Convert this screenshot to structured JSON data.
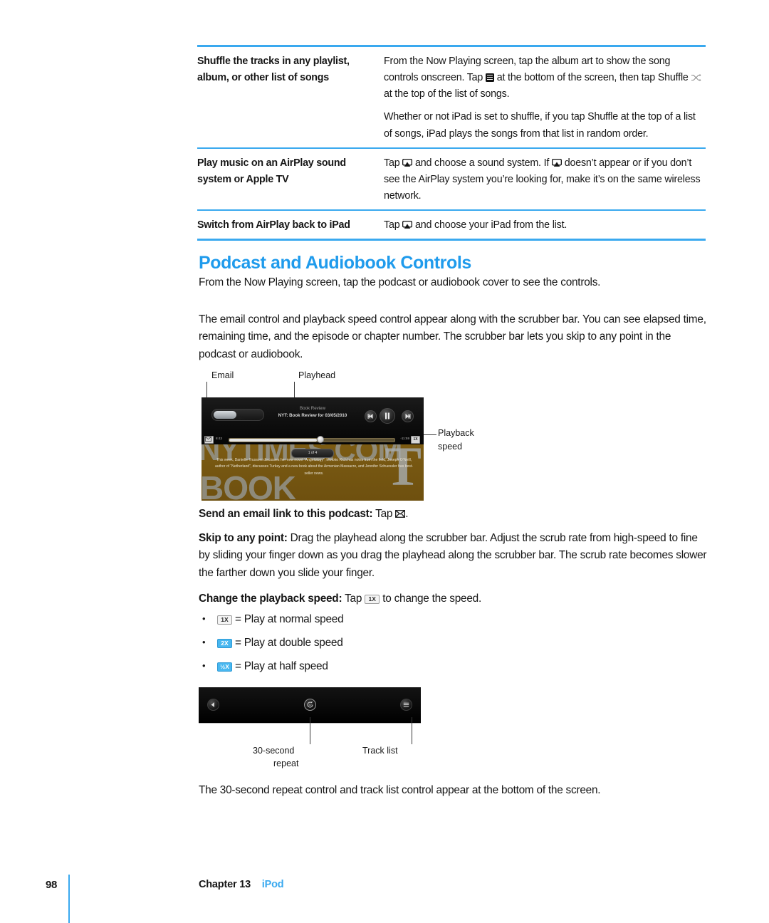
{
  "page": {
    "number": "98",
    "chapter_label": "Chapter 13",
    "section_label": "iPod",
    "accent_blue": "#3aa9ef",
    "heading_blue": "#1f9bec"
  },
  "table": {
    "rows": [
      {
        "task": "Shuffle the tracks in any playlist, album, or other list of songs",
        "steps": [
          "From the Now Playing screen, tap the album art to show the song controls onscreen. Tap  at the bottom of the screen, then tap Shuffle  at the top of the list of songs.",
          "Whether or not iPad is set to shuffle, if you tap Shuffle at the top of a list of songs, iPad plays the songs from that list in random order."
        ],
        "step1_a": "From the Now Playing screen, tap the album art to show the song controls onscreen. Tap",
        "step1_b": "at the bottom of the screen, then tap Shuffle",
        "step1_c": "at the top of the list of songs.",
        "step2": "Whether or not iPad is set to shuffle, if you tap Shuffle at the top of a list of songs, iPad plays the songs from that list in random order."
      },
      {
        "task": "Play music on an AirPlay sound system or Apple TV",
        "step_a": "Tap",
        "step_b": "and choose a sound system. If",
        "step_c": "doesn’t appear or if you don’t see the AirPlay system you’re looking for, make it’s on the same wireless network."
      },
      {
        "task": "Switch from AirPlay back to iPad",
        "step_a": "Tap",
        "step_b": "and choose your iPad from the list."
      }
    ]
  },
  "heading": "Podcast and Audiobook Controls",
  "paragraphs": {
    "intro": "From the Now Playing screen, tap the podcast or audiobook cover to see the controls.",
    "detail": "The email control and playback speed control appear along with the scrubber bar. You can see elapsed time, remaining time, and the episode or chapter number. The scrubber bar lets you skip to any point in the podcast or audiobook.",
    "closing": "The 30-second repeat control and track list control appear at the bottom of the screen."
  },
  "figure1": {
    "callouts": {
      "email": "Email",
      "playhead": "Playhead",
      "playback_speed_line1": "Playback",
      "playback_speed_line2": "speed"
    },
    "player": {
      "now_playing_title": "Book Review",
      "now_playing_subtitle": "NYT: Book Review for 03/05/2010",
      "elapsed": "8:43",
      "remaining": "-11:59",
      "speed_button": "1X",
      "chapter_indicator": "1 of 4",
      "cover_word_1": "NYTIMES.COM",
      "cover_word_2": "BOOK",
      "cover_mark": "T",
      "cover_blurb": "This week, Danielle Trussoni discusses her new novel “Angelology”;  Motoko Rich has notes from the field, Joseph O’Neill, author of “Netherland”, discusses  Turkey and a new book about the Armenian Massacre, and Jennifer Schuessler has best-seller news."
    }
  },
  "instructions": {
    "email_label": "Send an email link to this podcast:",
    "email_text_a": "Tap",
    "email_text_b": ".",
    "skip_label": "Skip to any point:",
    "skip_text": "Drag the playhead along the scrubber bar. Adjust the scrub rate from high-speed to fine by sliding your finger down as you drag the playhead along the scrubber bar. The scrub rate becomes slower the farther down you slide your finger.",
    "speed_label": "Change the playback speed:",
    "speed_text_a": "Tap",
    "speed_text_b": "to change the speed."
  },
  "speed_options": [
    {
      "chip": "1X",
      "text": "= Play at normal speed"
    },
    {
      "chip": "2X",
      "text": "= Play at double speed"
    },
    {
      "chip": "½X",
      "text": "= Play at half speed"
    }
  ],
  "figure2": {
    "callouts": {
      "repeat_line1": "30-second",
      "repeat_line2": "repeat",
      "track_list": "Track list"
    }
  }
}
